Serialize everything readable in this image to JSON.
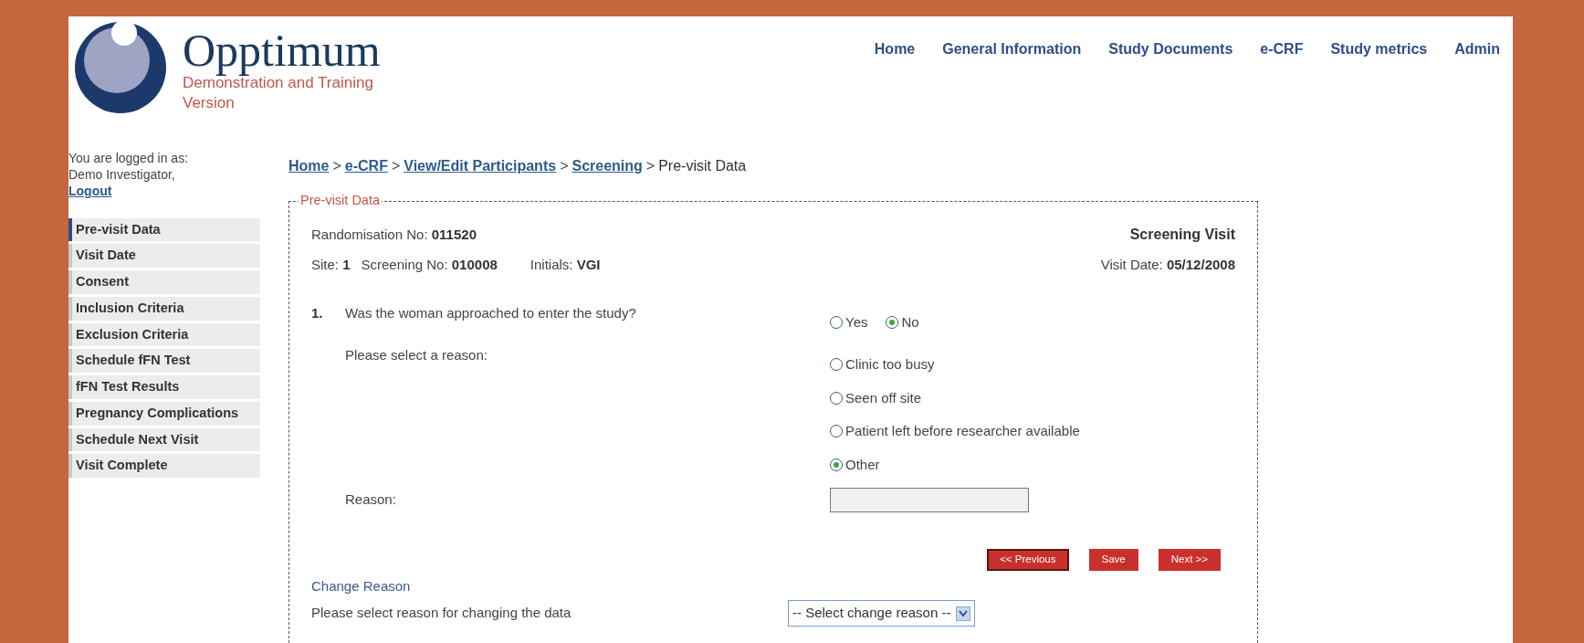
{
  "logo": {
    "title": "Opptimum",
    "subtitle": "Demonstration and Training Version"
  },
  "nav": [
    {
      "label": "Home"
    },
    {
      "label": "General Information"
    },
    {
      "label": "Study Documents"
    },
    {
      "label": "e-CRF"
    },
    {
      "label": "Study metrics"
    },
    {
      "label": "Admin"
    }
  ],
  "user": {
    "intro": "You are logged in as:",
    "name": "Demo Investigator,",
    "logout": "Logout"
  },
  "sidebar": {
    "items": [
      {
        "label": "Pre-visit Data",
        "selected": true
      },
      {
        "label": "Visit Date",
        "selected": false
      },
      {
        "label": "Consent",
        "selected": false
      },
      {
        "label": "Inclusion Criteria",
        "selected": false
      },
      {
        "label": "Exclusion Criteria",
        "selected": false
      },
      {
        "label": "Schedule fFN Test",
        "selected": false
      },
      {
        "label": "fFN Test Results",
        "selected": false
      },
      {
        "label": "Pregnancy Complications",
        "selected": false
      },
      {
        "label": "Schedule Next Visit",
        "selected": false
      },
      {
        "label": "Visit Complete",
        "selected": false
      }
    ]
  },
  "breadcrumb": {
    "separator": ">",
    "items": [
      {
        "label": "Home",
        "link": true
      },
      {
        "label": "e-CRF",
        "link": true
      },
      {
        "label": "View/Edit Participants",
        "link": true
      },
      {
        "label": "Screening",
        "link": true
      },
      {
        "label": "Pre-visit Data",
        "link": false
      }
    ]
  },
  "form": {
    "legend": "Pre-visit Data",
    "randomisation_label": "Randomisation No:",
    "randomisation_no": "011520",
    "visit_type": "Screening Visit",
    "site_label": "Site:",
    "site": "1",
    "screening_label": "Screening No:",
    "screening_no": "010008",
    "initials_label": "Initials:",
    "initials": "VGI",
    "visit_date_label": "Visit Date:",
    "visit_date": "05/12/2008",
    "question": {
      "number": "1.",
      "text": "Was the woman approached to enter the study?",
      "options": [
        {
          "label": "Yes",
          "selected": false
        },
        {
          "label": "No",
          "selected": true
        }
      ]
    },
    "reason_prompt": "Please select a reason:",
    "reasons": [
      {
        "label": "Clinic too busy",
        "selected": false
      },
      {
        "label": "Seen off site",
        "selected": false
      },
      {
        "label": "Patient left before researcher available",
        "selected": false
      },
      {
        "label": "Other",
        "selected": true
      }
    ],
    "reason_field": {
      "label": "Reason:"
    },
    "buttons": [
      {
        "label": "<< Previous",
        "focused": true
      },
      {
        "label": "Save",
        "focused": false
      },
      {
        "label": "Next >>",
        "focused": false
      }
    ],
    "change_reason": {
      "heading": "Change Reason",
      "prompt": "Please select reason for changing the data",
      "select": {
        "value": "-- Select change reason --"
      }
    }
  }
}
